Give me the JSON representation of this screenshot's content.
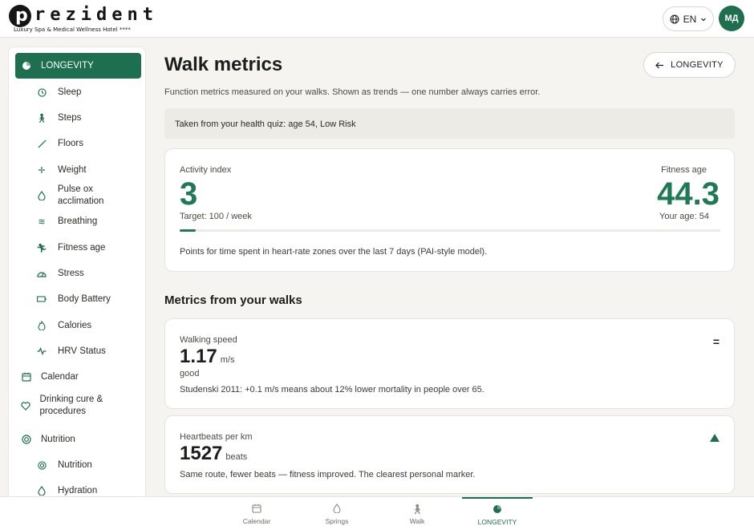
{
  "brand": {
    "logo_letter": "p",
    "name": "rezident",
    "tagline": "Luxury Spa & Medical Wellness Hotel ****"
  },
  "header": {
    "language": "EN",
    "avatar_initials": "МД"
  },
  "sidebar": {
    "items": [
      {
        "label": "LONGEVITY",
        "icon": "longevity-icon"
      },
      {
        "label": "Sleep",
        "icon": "clock-icon"
      },
      {
        "label": "Steps",
        "icon": "walking-icon"
      },
      {
        "label": "Floors",
        "icon": "stairs-icon"
      },
      {
        "label": "Weight",
        "icon": "weight-icon"
      },
      {
        "label": "Pulse ox acclimation",
        "icon": "drop-icon"
      },
      {
        "label": "Breathing",
        "icon": "wind-icon"
      },
      {
        "label": "Fitness age",
        "icon": "runner-icon"
      },
      {
        "label": "Stress",
        "icon": "gauge-icon"
      },
      {
        "label": "Body Battery",
        "icon": "battery-icon"
      },
      {
        "label": "Calories",
        "icon": "flame-icon"
      },
      {
        "label": "HRV Status",
        "icon": "pulse-icon"
      },
      {
        "label": "Calendar",
        "icon": "calendar-icon"
      },
      {
        "label": "Drinking cure & procedures",
        "icon": "heart-icon"
      },
      {
        "label": "Nutrition",
        "icon": "target-icon"
      },
      {
        "label": "Nutrition",
        "icon": "target-icon"
      },
      {
        "label": "Hydration",
        "icon": "drop-icon"
      }
    ]
  },
  "main": {
    "title": "Walk metrics",
    "back_button": "LONGEVITY",
    "intro": "Function metrics measured on your walks. Shown as trends — one number always carries error.",
    "quiz_banner": "Taken from your health quiz: age 54, Low Risk",
    "activity": {
      "label": "Activity index",
      "value": "3",
      "target": "Target: 100 / week",
      "progress_fraction": 0.03,
      "fitness_age_label": "Fitness age",
      "fitness_age_value": "44.3",
      "your_age": "Your age: 54",
      "description": "Points for time spent in heart-rate zones over the last 7 days (PAI-style model)."
    },
    "section_title": "Metrics from your walks",
    "metrics": [
      {
        "label": "Walking speed",
        "value": "1.17",
        "unit": "m/s",
        "status": "good",
        "note": "Studenski 2011: +0.1 m/s means about 12% lower mortality in people over 65.",
        "trend": "="
      },
      {
        "label": "Heartbeats per km",
        "value": "1527",
        "unit": "beats",
        "note": "Same route, fewer beats — fitness improved. The clearest personal marker.",
        "trend": "up"
      }
    ]
  },
  "bottom_nav": [
    {
      "label": "Calendar",
      "icon": "calendar-icon"
    },
    {
      "label": "Springs",
      "icon": "drop-icon"
    },
    {
      "label": "Walk",
      "icon": "walking-icon"
    },
    {
      "label": "LONGEVITY",
      "icon": "longevity-icon",
      "active": true
    }
  ]
}
